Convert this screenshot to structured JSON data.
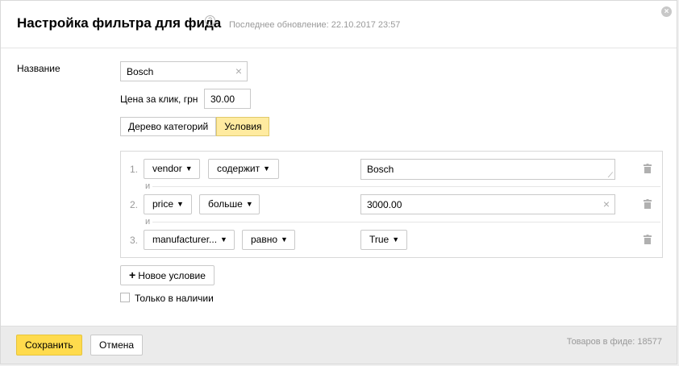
{
  "header": {
    "title": "Настройка фильтра для фида",
    "help_icon": "?",
    "last_update": "Последнее обновление: 22.10.2017 23:57",
    "close_icon": "×"
  },
  "form": {
    "name_label": "Название",
    "name_value": "Bosch",
    "price_label": "Цена за клик, грн",
    "price_value": "30.00",
    "tabs": [
      {
        "label": "Дерево категорий",
        "active": false
      },
      {
        "label": "Условия",
        "active": true
      }
    ]
  },
  "conditions": {
    "and_label": "и",
    "rows": [
      {
        "num": "1.",
        "field": "vendor",
        "operator": "содержит",
        "value": "Bosch"
      },
      {
        "num": "2.",
        "field": "price",
        "operator": "больше",
        "value": "3000.00"
      },
      {
        "num": "3.",
        "field": "manufacturer...",
        "operator": "равно",
        "value": "True"
      }
    ]
  },
  "add_condition_label": "Новое условие",
  "add_condition_icon": "+",
  "in_stock_label": "Только в наличии",
  "in_stock_checked": false,
  "footer": {
    "save_label": "Сохранить",
    "cancel_label": "Отмена",
    "goods_count": "Товаров в фиде: 18577"
  },
  "colors": {
    "accent": "#ffdb4d",
    "tab_active": "#ffeba0"
  }
}
